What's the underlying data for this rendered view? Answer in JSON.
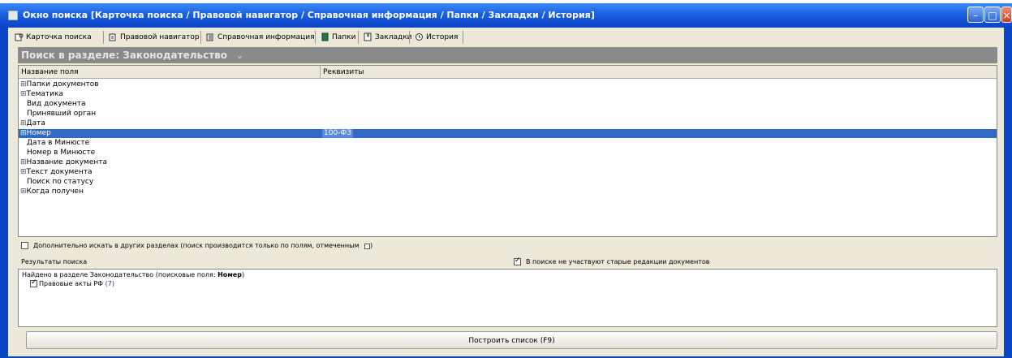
{
  "window": {
    "title": "Окно поиска [Карточка поиска / Правовой навигатор / Справочная информация / Папки / Закладки / История]"
  },
  "tabs": [
    {
      "label": "Карточка поиска",
      "icon": "search-card-icon"
    },
    {
      "label": "Правовой навигатор",
      "icon": "navigator-icon"
    },
    {
      "label": "Справочная информация",
      "icon": "reference-icon"
    },
    {
      "label": "Папки",
      "icon": "folder-icon"
    },
    {
      "label": "Закладки",
      "icon": "bookmark-icon"
    },
    {
      "label": "История",
      "icon": "history-icon"
    }
  ],
  "section": {
    "title": "Поиск в разделе: Законодательство",
    "chevron": "⌄"
  },
  "grid": {
    "columns": [
      "Название поля",
      "Реквизиты"
    ],
    "rows": [
      {
        "expander": "⊞",
        "name": "Папки документов",
        "value": ""
      },
      {
        "expander": "⊞",
        "name": "Тематика",
        "value": ""
      },
      {
        "expander": "",
        "name": "Вид документа",
        "value": ""
      },
      {
        "expander": "",
        "name": "Принявший орган",
        "value": ""
      },
      {
        "expander": "⊞",
        "name": "Дата",
        "value": ""
      },
      {
        "expander": "⊞",
        "name": "Номер",
        "value": "100-ФЗ",
        "selected": true
      },
      {
        "expander": "",
        "name": "Дата в Минюсте",
        "value": ""
      },
      {
        "expander": "",
        "name": "Номер в Минюсте",
        "value": ""
      },
      {
        "expander": "⊞",
        "name": "Название документа",
        "value": ""
      },
      {
        "expander": "⊞",
        "name": "Текст документа",
        "value": ""
      },
      {
        "expander": "",
        "name": "Поиск по статусу",
        "value": ""
      },
      {
        "expander": "⊞",
        "name": "Когда получен",
        "value": ""
      }
    ]
  },
  "options": {
    "extra_search_label": "Дополнительно искать в других разделах (поиск производится только по полям, отмеченным",
    "extra_search_suffix": ")",
    "old_editions_label": "В поиске не участвуют старые редакции документов"
  },
  "results": {
    "label": "Результаты поиска",
    "found_prefix": "Найдено в разделе Законодательство (поисковые поля:",
    "found_field": "Номер",
    "found_suffix": ")",
    "item_label": "Правовые акты РФ",
    "item_count": "(7)"
  },
  "build_button": {
    "label": "Построить список (F9)"
  },
  "colors": {
    "title_bar": "#1a5fe0",
    "selection": "#316ac5",
    "section_header": "#8a8a8a"
  }
}
